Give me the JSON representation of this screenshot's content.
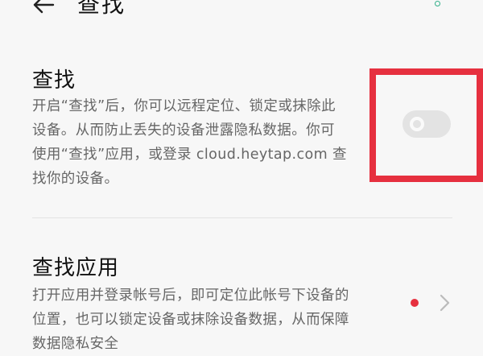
{
  "header": {
    "title": "查找",
    "back_icon": "arrow-left-icon"
  },
  "find_section": {
    "title": "查找",
    "description_lines": [
      "开启“查找”后，你可以远程定位、锁定或抹除此",
      "设备。从而防止丢失的设备泄露隐私数据。你可",
      "使用“查找”应用，或登录 cloud.heytap.com 查",
      "找你的设备。"
    ],
    "toggle_on": false
  },
  "find_app_section": {
    "title": "查找应用",
    "description_lines": [
      "打开应用并登录帐号后，即可定位此帐号下设备的",
      "位置，也可以锁定设备或抹除设备数据，从而保障",
      "数据隐私安全"
    ],
    "has_badge": true,
    "chevron_icon": "chevron-right-icon"
  },
  "colors": {
    "accent_red": "#e6303f",
    "status_green": "#33b08a",
    "toggle_off": "#e3e3e3"
  }
}
